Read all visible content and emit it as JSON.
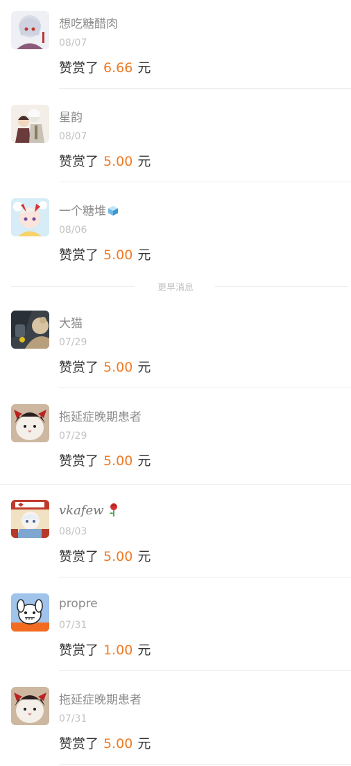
{
  "reward_prefix": "赞赏了",
  "reward_suffix": "元",
  "earlier_label": "更早消息",
  "colors": {
    "amount": "#f07a24",
    "name": "#8a8a8a",
    "date": "#c2c2c2",
    "text": "#333333"
  },
  "items": [
    {
      "name": "想吃糖醋肉",
      "date": "08/07",
      "amount": "6.66"
    },
    {
      "name": "星韵",
      "date": "08/07",
      "amount": "5.00"
    },
    {
      "name": "一个糖堆",
      "date": "08/06",
      "amount": "5.00",
      "name_icon": "ice-cube-emoji"
    },
    {
      "name": "大猫",
      "date": "07/29",
      "amount": "5.00"
    },
    {
      "name": "拖延症晚期患者",
      "date": "07/29",
      "amount": "5.00"
    },
    {
      "name": "vkafew",
      "date": "08/03",
      "amount": "5.00",
      "name_icon": "rose-emoji"
    },
    {
      "name": "propre",
      "date": "07/31",
      "amount": "1.00"
    },
    {
      "name": "拖延症晚期患者",
      "date": "07/31",
      "amount": "5.00"
    }
  ]
}
